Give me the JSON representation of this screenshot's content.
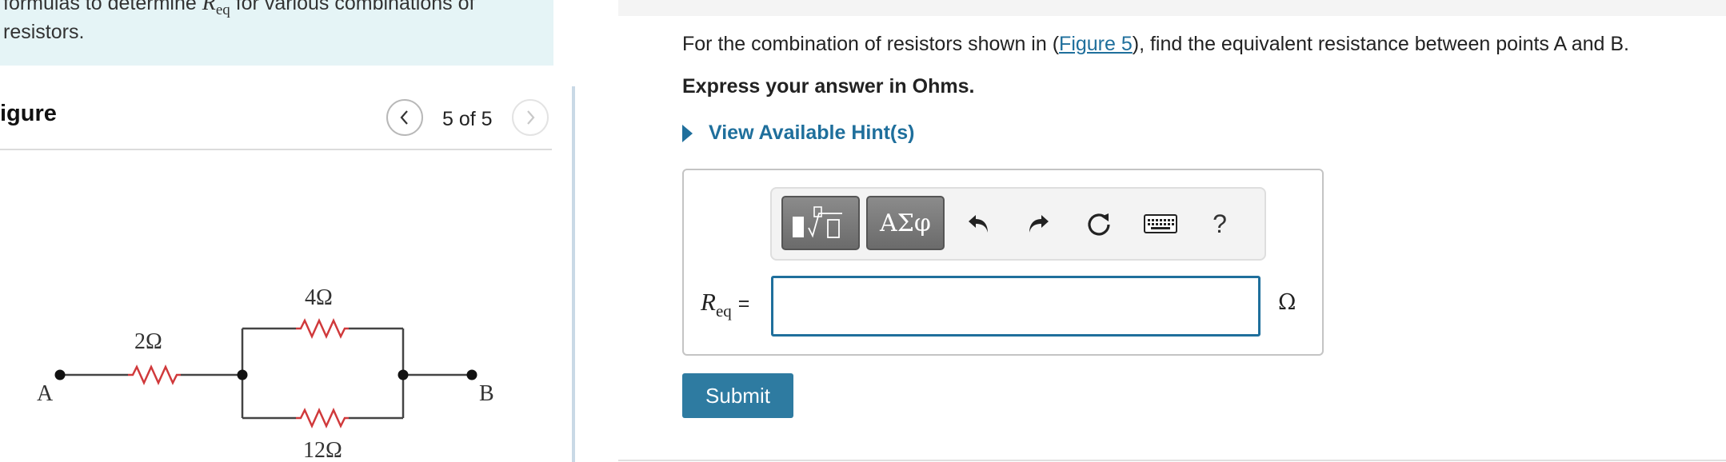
{
  "intro": {
    "line1_prefix": "formulas to determine ",
    "line1_symbol": "R",
    "line1_subscript": "eq",
    "line1_suffix": " for various combinations of",
    "line2": "resistors."
  },
  "figure": {
    "title": "igure",
    "counter": "5 of 5",
    "labels": {
      "point_a": "A",
      "point_b": "B",
      "r_series": "2Ω",
      "r_top": "4Ω",
      "r_bottom": "12Ω"
    }
  },
  "question": {
    "prefix": "For the combination of resistors shown in (",
    "link": "Figure 5",
    "suffix": "), find the equivalent resistance between points A and B.",
    "instruction": "Express your answer in Ohms.",
    "hints_label": "View Available Hint(s)"
  },
  "toolbar": {
    "templates_icon": "templates-icon",
    "greek_label": "ΑΣφ",
    "undo_icon": "undo-icon",
    "redo_icon": "redo-icon",
    "reset_icon": "reset-icon",
    "keyboard_icon": "keyboard-icon",
    "help_label": "?"
  },
  "answer": {
    "label_symbol": "R",
    "label_subscript": "eq",
    "label_equals": "=",
    "value": "",
    "unit": "Ω"
  },
  "submit_label": "Submit",
  "colors": {
    "accent": "#1f6f9c",
    "submit": "#2e7ba1",
    "info_bg": "#e5f4f6",
    "resistor": "#d0393b"
  }
}
